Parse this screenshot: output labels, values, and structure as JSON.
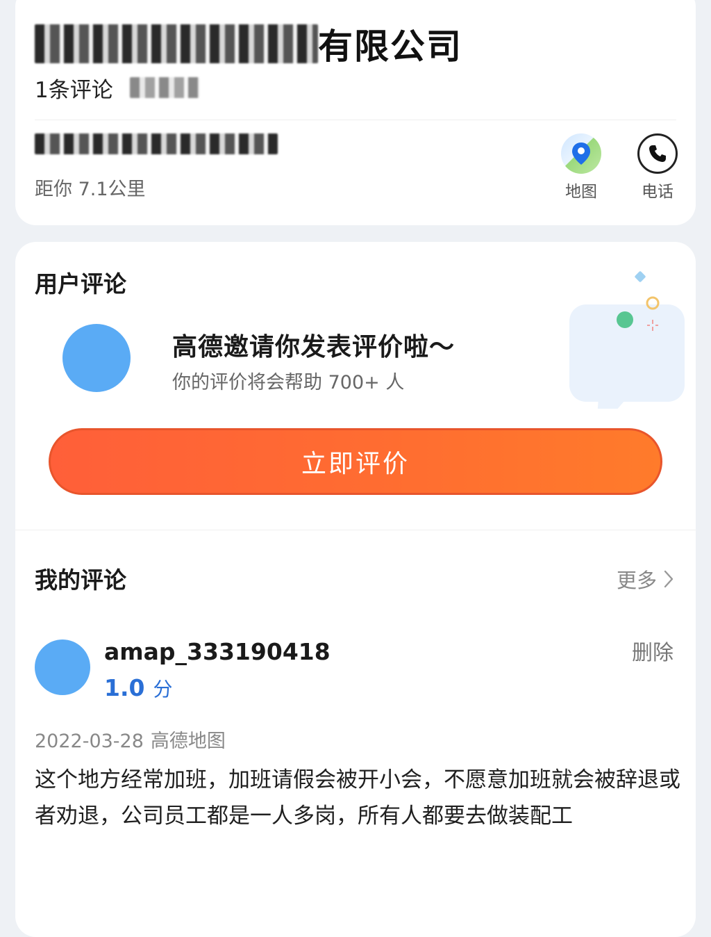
{
  "header": {
    "company_suffix": "有限公司",
    "review_count": "1条评论",
    "distance": "距你 7.1公里",
    "actions": [
      {
        "label": "地图",
        "icon": "map-pin-icon"
      },
      {
        "label": "电话",
        "icon": "phone-icon"
      }
    ]
  },
  "user_reviews": {
    "title": "用户评论",
    "invite_title": "高德邀请你发表评价啦～",
    "invite_sub": "你的评价将会帮助 700+ 人",
    "rate_button": "立即评价"
  },
  "my_reviews": {
    "title": "我的评论",
    "more": "更多",
    "review": {
      "username": "amap_333190418",
      "score": "1.0",
      "score_unit": "分",
      "delete": "删除",
      "date": "2022-03-28",
      "source": "高德地图",
      "content": "这个地方经常加班，加班请假会被开小会，不愿意加班就会被辞退或者劝退，公司员工都是一人多岗，所有人都要去做装配工"
    }
  },
  "colors": {
    "accent_orange": "#ff6a33",
    "score_blue": "#2a6fd6",
    "avatar_blue": "#5aabf5"
  }
}
